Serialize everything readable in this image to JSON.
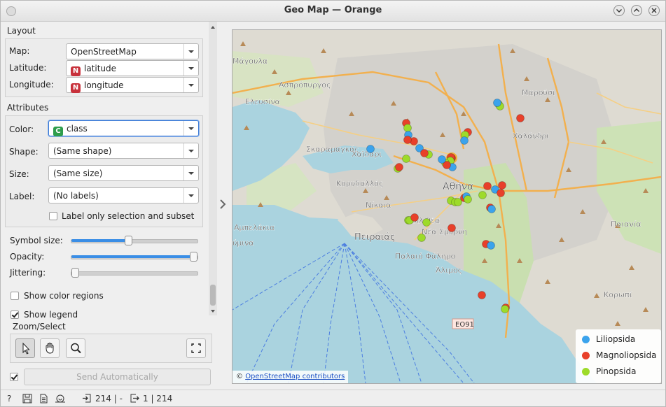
{
  "window": {
    "title": "Geo Map — Orange"
  },
  "layout": {
    "section_title": "Layout",
    "map_label": "Map:",
    "map_value": "OpenStreetMap",
    "latitude_label": "Latitude:",
    "latitude_badge": "N",
    "latitude_value": "latitude",
    "longitude_label": "Longitude:",
    "longitude_badge": "N",
    "longitude_value": "longitude"
  },
  "attributes": {
    "section_title": "Attributes",
    "color_label": "Color:",
    "color_badge": "C",
    "color_value": "class",
    "shape_label": "Shape:",
    "shape_value": "(Same shape)",
    "size_label": "Size:",
    "size_value": "(Same size)",
    "label_label": "Label:",
    "label_value": "(No labels)",
    "label_only_selection": "Label only selection and subset"
  },
  "sliders": {
    "symbol_size_label": "Symbol size:",
    "symbol_size_level": 0.45,
    "opacity_label": "Opacity:",
    "opacity_level": 1.0,
    "jittering_label": "Jittering:",
    "jittering_level": 0.0
  },
  "options": {
    "show_color_regions": "Show color regions",
    "show_color_regions_checked": false,
    "show_legend": "Show legend",
    "show_legend_checked": true
  },
  "zoom": {
    "title": "Zoom/Select"
  },
  "send": {
    "label": "Send Automatically",
    "checked": true
  },
  "status": {
    "input_count": "214 | -",
    "output_count": "1 | 214"
  },
  "map": {
    "places": [
      "Ασπρόπυργος",
      "Ελευσίνα",
      "Σκαραμαγκάς",
      "Χαϊδάρι",
      "Κορυδαλλός",
      "Νίκαια",
      "Αμπελάκια",
      "Πειραιάς",
      "Καλλιθέα",
      "Νέα Σμύρνη",
      "Παλαιό Φάληρο",
      "Άλιμος",
      "Αθήνα",
      "Μαρούσι",
      "Χαλάνδρι",
      "Παιανία",
      "Κορωπί",
      "Μάγουλα",
      "ύμινα"
    ],
    "road_label": "ΕΟ91",
    "attribution_prefix": "©",
    "attribution_link": "OpenStreetMap contributors"
  },
  "legend": {
    "items": [
      {
        "label": "Liliopsida",
        "color": "#3ba3ec"
      },
      {
        "label": "Magnoliopsida",
        "color": "#e8402a"
      },
      {
        "label": "Pinopsida",
        "color": "#9ddb2a"
      }
    ]
  },
  "points": {
    "blue": "#3ba3ec",
    "red": "#e8402a",
    "green": "#9ddb2a"
  }
}
